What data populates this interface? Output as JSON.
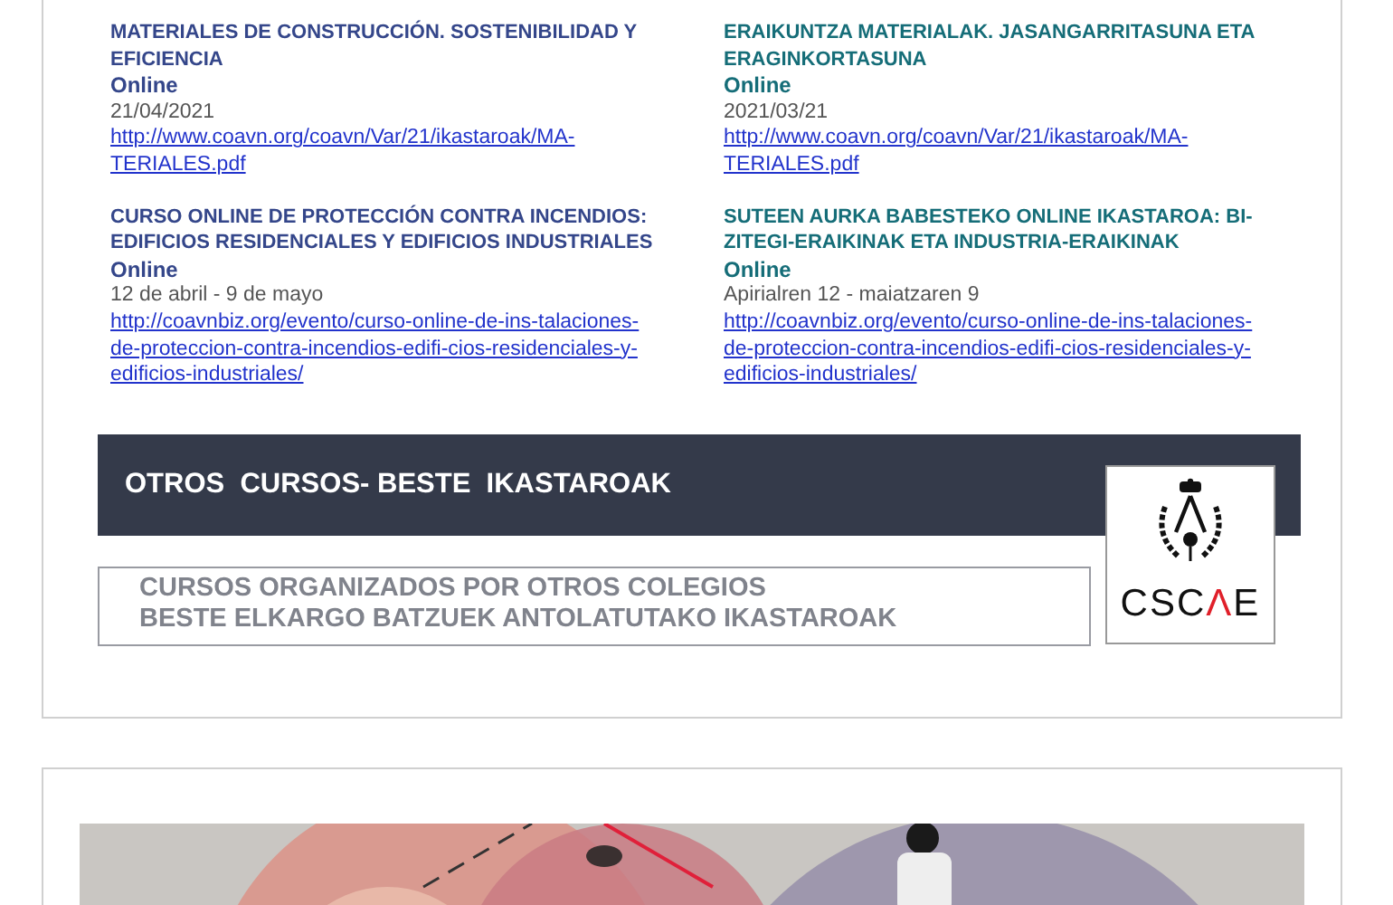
{
  "courses": [
    {
      "color": "#34468a",
      "title": "MATERIALES DE CONSTRUCCIÓN. SOSTENIBILIDAD Y EFICIENCIA",
      "mode": "Online",
      "date": "21/04/2021",
      "link": "http://www.coavn.org/coavn/Var/21/ikastaroak/MA-TERIALES.pdf"
    },
    {
      "color": "#156d78",
      "title": "ERAIKUNTZA MATERIALAK. JASANGARRITASUNA ETA ERAGINKORTASUNA",
      "mode": "Online",
      "date": "2021/03/21",
      "link": "http://www.coavn.org/coavn/Var/21/ikastaroak/MA-TERIALES.pdf"
    },
    {
      "color": "#34468a",
      "title": "CURSO ONLINE DE PROTECCIÓN CONTRA INCENDIOS: EDIFICIOS RESIDENCIALES Y EDIFICIOS INDUSTRIALES",
      "mode": "Online",
      "date": "12 de abril - 9 de mayo",
      "link": "http://coavnbiz.org/evento/curso-online-de-ins-talaciones-de-proteccion-contra-incendios-edifi-cios-residenciales-y-edificios-industriales/"
    },
    {
      "color": "#156d78",
      "title": "SUTEEN AURKA BABESTEKO ONLINE IKASTAROA: BI-ZITEGI-ERAIKINAK ETA INDUSTRIA-ERAIKINAK",
      "mode": "Online",
      "date": "Apirialren 12 - maiatzaren 9",
      "link": "http://coavnbiz.org/evento/curso-online-de-ins-talaciones-de-proteccion-contra-incendios-edifi-cios-residenciales-y-edificios-industriales/"
    }
  ],
  "banner": {
    "title": "OTROS  CURSOS- BESTE  IKASTAROAK",
    "subtitle_lines": [
      "CURSOS ORGANIZADOS POR OTROS COLEGIOS",
      "BESTE ELKARGO BATZUEK ANTOLATUTAKO IKASTAROAK"
    ],
    "logo_text": [
      {
        "text": "CSC",
        "accent": false
      },
      {
        "text": "Λ",
        "accent": true
      },
      {
        "text": "E",
        "accent": false
      }
    ]
  }
}
